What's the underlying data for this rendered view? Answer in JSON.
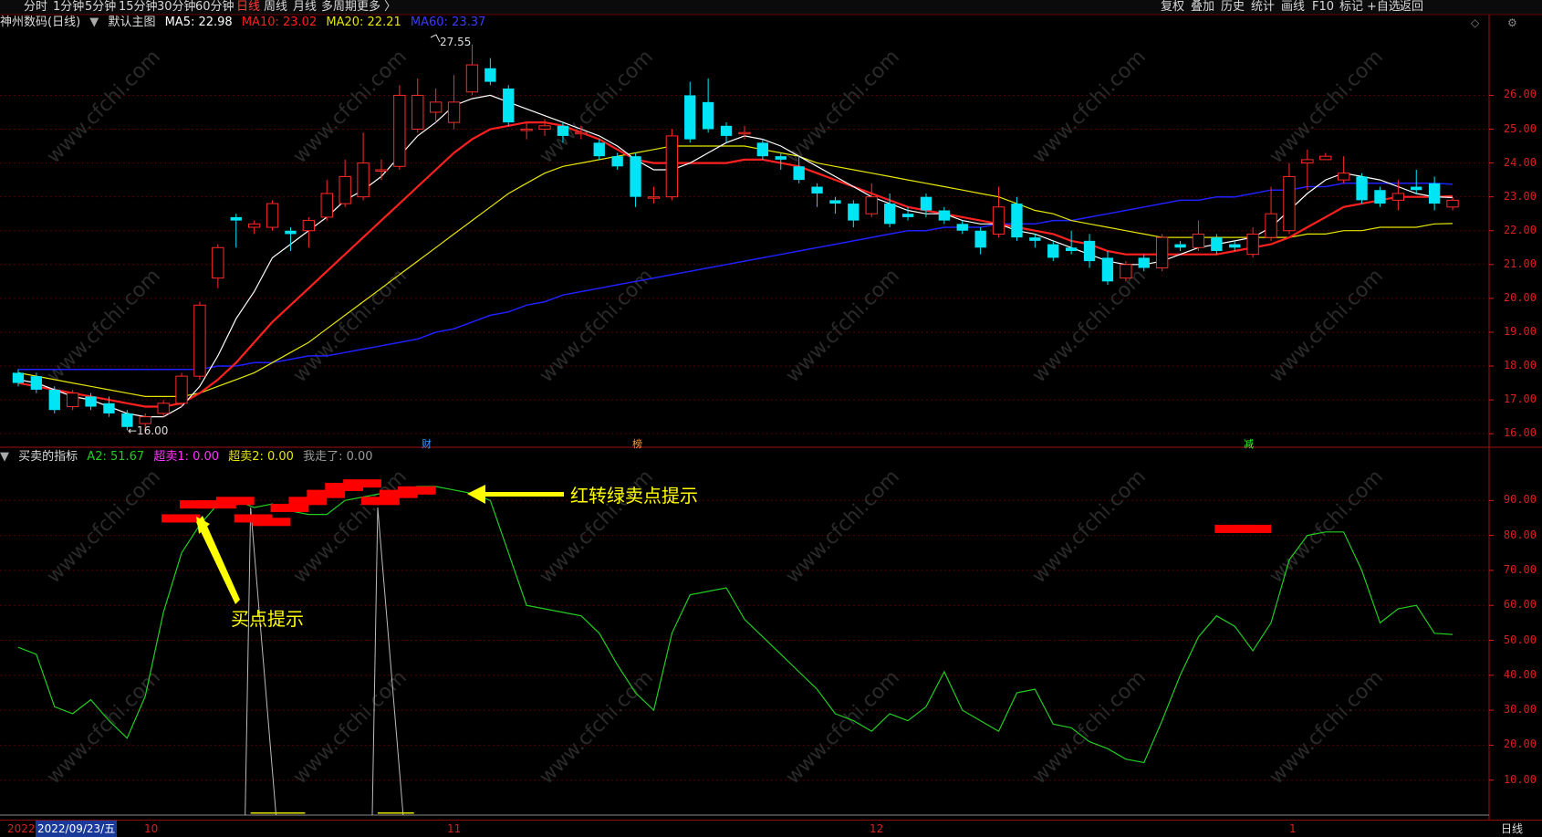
{
  "timeframes": [
    "分时",
    "1分钟",
    "5分钟",
    "15分钟",
    "30分钟",
    "60分钟",
    "日线",
    "周线",
    "月线",
    "多周期",
    "更多 〉"
  ],
  "active_timeframe": "日线",
  "right_tools": [
    "复权",
    "叠加",
    "历史",
    "统计",
    "画线",
    "F10",
    "标记",
    "+自选",
    "返回"
  ],
  "main_legend": {
    "stock": "神州数码(日线)",
    "template": "默认主图",
    "ma5": "MA5: 22.98",
    "ma10": "MA10: 23.02",
    "ma20": "MA20: 22.21",
    "ma60": "MA60: 23.37"
  },
  "indicator_legend": {
    "name": "买卖的指标",
    "a2": "A2: 51.67",
    "chaomai1": "超卖1: 0.00",
    "chaomai2": "超卖2: 0.00",
    "wozoule": "我走了: 0.00"
  },
  "colors": {
    "ma5": "#ffffff",
    "ma10": "#ff2020",
    "ma20": "#e6e600",
    "ma60": "#2020ff",
    "up": "#ff2a2a",
    "down": "#00e5f5",
    "grid": "#550000",
    "axis": "#d82020",
    "indicator": "#22cc22",
    "signal": "#ff0000",
    "annotation": "#ffff00"
  },
  "price_axis_labels": [
    "26.00",
    "25.00",
    "24.00",
    "23.00",
    "22.00",
    "21.00",
    "20.00",
    "19.00",
    "18.00",
    "17.00",
    "16.00"
  ],
  "indicator_axis_labels": [
    "90.00",
    "80.00",
    "70.00",
    "60.00",
    "50.00",
    "40.00",
    "30.00",
    "20.00",
    "10.00"
  ],
  "high_marker": "27.55",
  "low_marker": "←16.00",
  "event_tags": [
    "财",
    "榜",
    "减"
  ],
  "annotations": {
    "buy": "买点提示",
    "sell": "红转绿卖点提示"
  },
  "dates": {
    "year": "2022",
    "current": "2022/09/23/五",
    "m10": "10",
    "m11": "11",
    "m12": "12",
    "m1": "1"
  },
  "period_label": "日线",
  "watermark": "www.cfchi.com",
  "chart_data": {
    "type": "candlestick",
    "series_names": [
      "MA5",
      "MA10",
      "MA20",
      "MA60"
    ],
    "candles": [
      [
        17.8,
        17.5,
        17.9,
        17.4
      ],
      [
        17.7,
        17.3,
        17.8,
        17.2
      ],
      [
        17.3,
        16.7,
        17.4,
        16.6
      ],
      [
        16.8,
        17.2,
        17.3,
        16.7
      ],
      [
        17.1,
        16.8,
        17.2,
        16.7
      ],
      [
        16.9,
        16.6,
        17.1,
        16.5
      ],
      [
        16.6,
        16.2,
        16.7,
        16.1
      ],
      [
        16.3,
        16.5,
        16.6,
        16.0
      ],
      [
        16.6,
        16.9,
        17.0,
        16.5
      ],
      [
        16.9,
        17.7,
        17.8,
        16.8
      ],
      [
        17.7,
        19.8,
        19.9,
        17.6
      ],
      [
        20.6,
        21.5,
        21.6,
        20.3
      ],
      [
        22.4,
        22.3,
        22.5,
        21.5
      ],
      [
        22.1,
        22.2,
        22.3,
        21.9
      ],
      [
        22.1,
        22.8,
        22.9,
        22.0
      ],
      [
        22.0,
        21.9,
        22.1,
        21.4
      ],
      [
        22.0,
        22.3,
        22.4,
        21.5
      ],
      [
        22.4,
        23.1,
        23.5,
        22.3
      ],
      [
        22.8,
        23.6,
        24.1,
        22.7
      ],
      [
        23.0,
        24.0,
        24.9,
        22.9
      ],
      [
        23.8,
        23.8,
        24.1,
        23.5
      ],
      [
        23.9,
        26.0,
        26.3,
        23.8
      ],
      [
        25.0,
        26.0,
        26.5,
        24.9
      ],
      [
        25.5,
        25.8,
        26.2,
        25.2
      ],
      [
        25.2,
        25.8,
        26.6,
        25.0
      ],
      [
        26.1,
        26.9,
        27.5,
        26.0
      ],
      [
        26.8,
        26.4,
        27.1,
        26.3
      ],
      [
        26.2,
        25.2,
        26.3,
        25.1
      ],
      [
        25.0,
        25.0,
        25.2,
        24.7
      ],
      [
        25.0,
        25.1,
        25.3,
        24.8
      ],
      [
        25.1,
        24.8,
        25.2,
        24.6
      ],
      [
        24.9,
        24.9,
        25.1,
        24.7
      ],
      [
        24.6,
        24.2,
        24.7,
        24.1
      ],
      [
        24.2,
        23.9,
        24.3,
        23.8
      ],
      [
        24.2,
        23.0,
        24.3,
        22.7
      ],
      [
        23.0,
        23.0,
        23.3,
        22.8
      ],
      [
        23.0,
        24.8,
        25.0,
        22.9
      ],
      [
        26.0,
        24.7,
        26.4,
        24.6
      ],
      [
        25.8,
        25.0,
        26.5,
        24.9
      ],
      [
        25.1,
        24.8,
        25.2,
        24.6
      ],
      [
        24.9,
        24.9,
        25.1,
        24.7
      ],
      [
        24.6,
        24.2,
        24.7,
        24.1
      ],
      [
        24.2,
        24.1,
        24.3,
        23.8
      ],
      [
        23.9,
        23.5,
        24.2,
        23.4
      ],
      [
        23.3,
        23.1,
        23.4,
        22.7
      ],
      [
        22.9,
        22.8,
        23.0,
        22.5
      ],
      [
        22.8,
        22.3,
        22.9,
        22.1
      ],
      [
        22.5,
        23.0,
        23.4,
        22.4
      ],
      [
        22.8,
        22.2,
        23.1,
        22.1
      ],
      [
        22.5,
        22.4,
        22.7,
        22.3
      ],
      [
        23.0,
        22.6,
        23.1,
        22.4
      ],
      [
        22.6,
        22.3,
        22.7,
        22.2
      ],
      [
        22.2,
        22.0,
        22.3,
        21.9
      ],
      [
        22.0,
        21.5,
        22.1,
        21.3
      ],
      [
        21.9,
        22.7,
        23.3,
        21.8
      ],
      [
        22.8,
        21.8,
        23.0,
        21.7
      ],
      [
        21.8,
        21.7,
        21.9,
        21.5
      ],
      [
        21.6,
        21.2,
        21.7,
        21.1
      ],
      [
        21.5,
        21.4,
        22.0,
        21.3
      ],
      [
        21.7,
        21.1,
        21.9,
        20.9
      ],
      [
        21.2,
        20.5,
        21.4,
        20.4
      ],
      [
        20.6,
        21.0,
        21.1,
        20.5
      ],
      [
        21.2,
        20.9,
        21.3,
        20.8
      ],
      [
        20.9,
        21.8,
        21.9,
        20.8
      ],
      [
        21.6,
        21.5,
        21.7,
        21.4
      ],
      [
        21.5,
        21.9,
        22.3,
        21.4
      ],
      [
        21.8,
        21.4,
        21.9,
        21.3
      ],
      [
        21.6,
        21.5,
        21.7,
        21.4
      ],
      [
        21.3,
        21.9,
        22.1,
        21.2
      ],
      [
        21.8,
        22.5,
        23.3,
        21.7
      ],
      [
        22.0,
        23.6,
        24.0,
        21.9
      ],
      [
        24.0,
        24.1,
        24.4,
        23.2
      ],
      [
        24.1,
        24.2,
        24.3,
        24.1
      ],
      [
        23.5,
        23.7,
        24.2,
        23.4
      ],
      [
        23.6,
        22.9,
        23.7,
        22.8
      ],
      [
        23.2,
        22.8,
        23.3,
        22.7
      ],
      [
        22.9,
        23.1,
        23.5,
        22.6
      ],
      [
        23.3,
        23.2,
        23.8,
        23.1
      ],
      [
        23.4,
        22.8,
        23.6,
        22.6
      ],
      [
        22.7,
        22.9,
        23.0,
        22.6
      ]
    ],
    "ma5": [
      17.6,
      17.5,
      17.3,
      17.1,
      17.0,
      16.8,
      16.6,
      16.5,
      16.5,
      16.8,
      17.4,
      18.3,
      19.4,
      20.2,
      21.2,
      21.6,
      22.0,
      22.4,
      22.9,
      23.2,
      23.6,
      24.2,
      24.8,
      25.2,
      25.7,
      25.9,
      26.0,
      25.8,
      25.6,
      25.4,
      25.2,
      25.0,
      24.8,
      24.5,
      24.1,
      23.8,
      23.8,
      24.0,
      24.3,
      24.6,
      24.8,
      24.7,
      24.5,
      24.2,
      23.9,
      23.6,
      23.3,
      23.0,
      22.8,
      22.6,
      22.5,
      22.5,
      22.3,
      22.2,
      22.2,
      22.0,
      21.9,
      21.7,
      21.5,
      21.3,
      21.1,
      21.0,
      21.0,
      21.1,
      21.3,
      21.5,
      21.6,
      21.7,
      21.8,
      22.1,
      22.6,
      23.1,
      23.5,
      23.7,
      23.6,
      23.5,
      23.3,
      23.1,
      23.0,
      22.98
    ],
    "ma10": [
      17.5,
      17.4,
      17.3,
      17.2,
      17.1,
      17.0,
      16.9,
      16.8,
      16.8,
      16.9,
      17.2,
      17.6,
      18.1,
      18.7,
      19.3,
      19.8,
      20.3,
      20.8,
      21.3,
      21.8,
      22.3,
      22.8,
      23.3,
      23.8,
      24.3,
      24.7,
      25.0,
      25.1,
      25.2,
      25.2,
      25.1,
      24.9,
      24.7,
      24.4,
      24.1,
      24.0,
      24.0,
      24.0,
      24.0,
      24.0,
      24.1,
      24.1,
      24.0,
      23.9,
      23.7,
      23.5,
      23.3,
      23.1,
      22.9,
      22.7,
      22.6,
      22.5,
      22.4,
      22.3,
      22.2,
      22.1,
      22.0,
      21.9,
      21.7,
      21.6,
      21.4,
      21.3,
      21.3,
      21.3,
      21.3,
      21.3,
      21.3,
      21.4,
      21.5,
      21.6,
      21.8,
      22.1,
      22.4,
      22.7,
      22.8,
      22.9,
      23.0,
      23.0,
      23.0,
      23.02
    ],
    "ma20": [
      17.8,
      17.7,
      17.6,
      17.5,
      17.4,
      17.3,
      17.2,
      17.1,
      17.1,
      17.1,
      17.2,
      17.4,
      17.6,
      17.8,
      18.1,
      18.4,
      18.7,
      19.1,
      19.5,
      19.9,
      20.3,
      20.7,
      21.1,
      21.5,
      21.9,
      22.3,
      22.7,
      23.1,
      23.4,
      23.7,
      23.9,
      24.0,
      24.1,
      24.2,
      24.3,
      24.4,
      24.5,
      24.5,
      24.5,
      24.5,
      24.5,
      24.4,
      24.3,
      24.2,
      24.0,
      23.9,
      23.8,
      23.7,
      23.6,
      23.5,
      23.4,
      23.3,
      23.2,
      23.1,
      23.0,
      22.8,
      22.6,
      22.5,
      22.3,
      22.2,
      22.1,
      22.0,
      21.9,
      21.8,
      21.8,
      21.8,
      21.8,
      21.8,
      21.8,
      21.8,
      21.8,
      21.9,
      21.9,
      22.0,
      22.0,
      22.1,
      22.1,
      22.1,
      22.2,
      22.21
    ],
    "ma60": [
      17.9,
      17.9,
      17.9,
      17.9,
      17.9,
      17.9,
      17.9,
      17.9,
      17.9,
      17.9,
      17.9,
      18.0,
      18.0,
      18.1,
      18.1,
      18.2,
      18.3,
      18.3,
      18.4,
      18.5,
      18.6,
      18.7,
      18.8,
      19.0,
      19.1,
      19.3,
      19.5,
      19.6,
      19.8,
      19.9,
      20.1,
      20.2,
      20.3,
      20.4,
      20.5,
      20.6,
      20.7,
      20.8,
      20.9,
      21.0,
      21.1,
      21.2,
      21.3,
      21.4,
      21.5,
      21.6,
      21.7,
      21.8,
      21.9,
      22.0,
      22.0,
      22.1,
      22.1,
      22.1,
      22.2,
      22.2,
      22.2,
      22.3,
      22.3,
      22.4,
      22.5,
      22.6,
      22.7,
      22.8,
      22.9,
      22.9,
      23.0,
      23.0,
      23.1,
      23.2,
      23.2,
      23.3,
      23.3,
      23.4,
      23.4,
      23.4,
      23.4,
      23.4,
      23.4,
      23.37
    ],
    "a2": [
      48,
      46,
      31,
      29,
      33,
      27,
      22,
      34,
      58,
      75,
      83,
      89,
      90,
      88,
      89,
      87,
      86,
      86,
      90,
      91,
      92,
      93,
      94,
      94,
      93,
      92,
      90,
      75,
      60,
      59,
      58,
      57,
      52,
      43,
      35,
      30,
      52,
      63,
      64,
      65,
      56,
      51,
      46,
      41,
      36,
      29,
      27,
      24,
      29,
      27,
      31,
      41,
      30,
      27,
      24,
      35,
      36,
      26,
      25,
      21,
      19,
      16,
      15,
      27,
      40,
      51,
      57,
      54,
      47,
      55,
      73,
      80,
      81,
      81,
      70,
      55,
      59,
      60,
      52,
      51.67
    ],
    "signals": [
      [
        9,
        85
      ],
      [
        10,
        89
      ],
      [
        11,
        89
      ],
      [
        12,
        90
      ],
      [
        13,
        85
      ],
      [
        14,
        84
      ],
      [
        15,
        88
      ],
      [
        16,
        90
      ],
      [
        17,
        92
      ],
      [
        18,
        94
      ],
      [
        19,
        95
      ],
      [
        20,
        90
      ],
      [
        21,
        92
      ],
      [
        22,
        93
      ],
      [
        67,
        82
      ],
      [
        68,
        82
      ]
    ],
    "xlim": [
      0,
      80
    ],
    "ylim_price": [
      15.6,
      27.9
    ],
    "ylim_indicator": [
      0,
      100
    ]
  }
}
